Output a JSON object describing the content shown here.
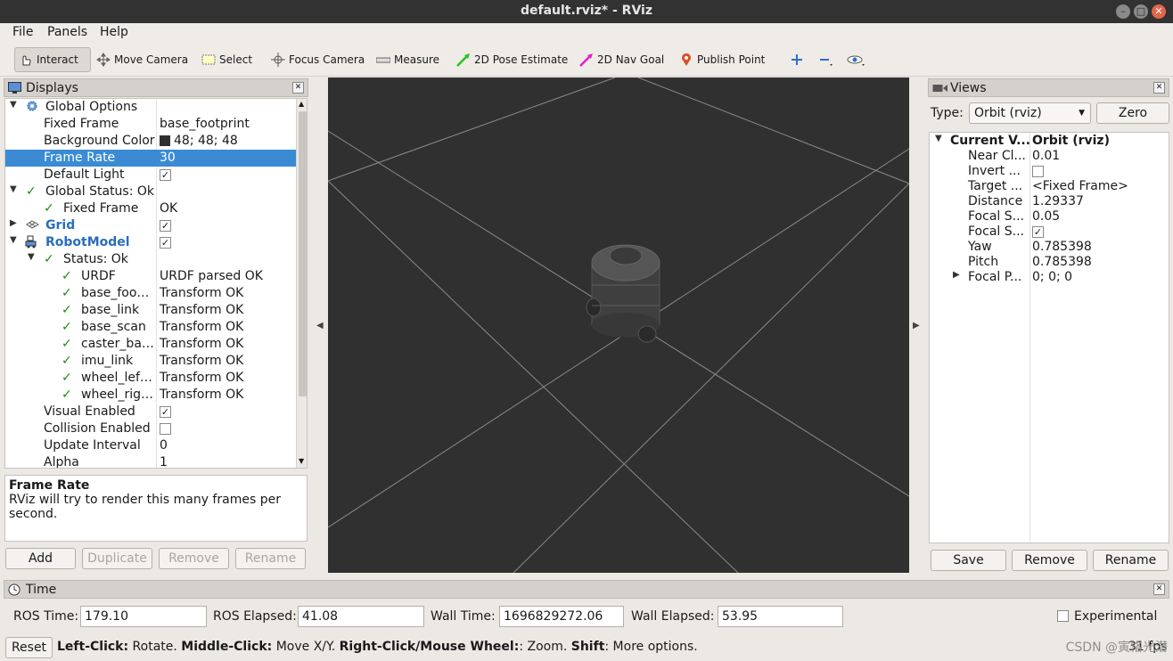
{
  "window": {
    "title": "default.rviz* - RViz"
  },
  "menu": [
    "File",
    "Panels",
    "Help"
  ],
  "toolbar": {
    "interact": "Interact",
    "move_camera": "Move Camera",
    "select": "Select",
    "focus_camera": "Focus Camera",
    "measure": "Measure",
    "pose_estimate": "2D Pose Estimate",
    "nav_goal": "2D Nav Goal",
    "publish_point": "Publish Point"
  },
  "displays": {
    "title": "Displays",
    "rows": [
      {
        "label": "Global Options",
        "value": ""
      },
      {
        "label": "Fixed Frame",
        "value": "base_footprint"
      },
      {
        "label": "Background Color",
        "value": "48; 48; 48"
      },
      {
        "label": "Frame Rate",
        "value": "30"
      },
      {
        "label": "Default Light",
        "value": ""
      },
      {
        "label": "Global Status: Ok",
        "value": ""
      },
      {
        "label": "Fixed Frame",
        "value": "OK"
      },
      {
        "label": "Grid",
        "value": ""
      },
      {
        "label": "RobotModel",
        "value": ""
      },
      {
        "label": "Status: Ok",
        "value": ""
      },
      {
        "label": "URDF",
        "value": "URDF parsed OK"
      },
      {
        "label": "base_foo…",
        "value": "Transform OK"
      },
      {
        "label": "base_link",
        "value": "Transform OK"
      },
      {
        "label": "base_scan",
        "value": "Transform OK"
      },
      {
        "label": "caster_ba…",
        "value": "Transform OK"
      },
      {
        "label": "imu_link",
        "value": "Transform OK"
      },
      {
        "label": "wheel_lef…",
        "value": "Transform OK"
      },
      {
        "label": "wheel_rig…",
        "value": "Transform OK"
      },
      {
        "label": "Visual Enabled",
        "value": ""
      },
      {
        "label": "Collision Enabled",
        "value": ""
      },
      {
        "label": "Update Interval",
        "value": "0"
      },
      {
        "label": "Alpha",
        "value": "1"
      }
    ],
    "background_color_hex": "#303030",
    "description_title": "Frame Rate",
    "description_text": "RViz will try to render this many frames per second.",
    "buttons": [
      "Add",
      "Duplicate",
      "Remove",
      "Rename"
    ]
  },
  "views": {
    "title": "Views",
    "type_label": "Type:",
    "type_value": "Orbit (rviz)",
    "zero": "Zero",
    "rows": [
      {
        "label": "Current V...",
        "value": "Orbit (rviz)"
      },
      {
        "label": "Near Cl...",
        "value": "0.01"
      },
      {
        "label": "Invert ...",
        "value": ""
      },
      {
        "label": "Target ...",
        "value": "<Fixed Frame>"
      },
      {
        "label": "Distance",
        "value": "1.29337"
      },
      {
        "label": "Focal S...",
        "value": "0.05"
      },
      {
        "label": "Focal S...",
        "value": ""
      },
      {
        "label": "Yaw",
        "value": "0.785398"
      },
      {
        "label": "Pitch",
        "value": "0.785398"
      },
      {
        "label": "Focal P...",
        "value": "0; 0; 0"
      }
    ],
    "buttons": [
      "Save",
      "Remove",
      "Rename"
    ]
  },
  "time": {
    "title": "Time",
    "ros_time_label": "ROS Time:",
    "ros_time": "179.10",
    "ros_elapsed_label": "ROS Elapsed:",
    "ros_elapsed": "41.08",
    "wall_time_label": "Wall Time:",
    "wall_time": "1696829272.06",
    "wall_elapsed_label": "Wall Elapsed:",
    "wall_elapsed": "53.95",
    "experimental": "Experimental",
    "reset": "Reset"
  },
  "status_bar": {
    "b1": "Left-Click:",
    "t1": " Rotate. ",
    "b2": "Middle-Click:",
    "t2": " Move X/Y. ",
    "b3": "Right-Click/Mouse Wheel:",
    "t3": ": Zoom. ",
    "b4": "Shift",
    "t4": ": More options.",
    "fps": "31 fps"
  },
  "watermark": "CSDN @寅恪光潜"
}
